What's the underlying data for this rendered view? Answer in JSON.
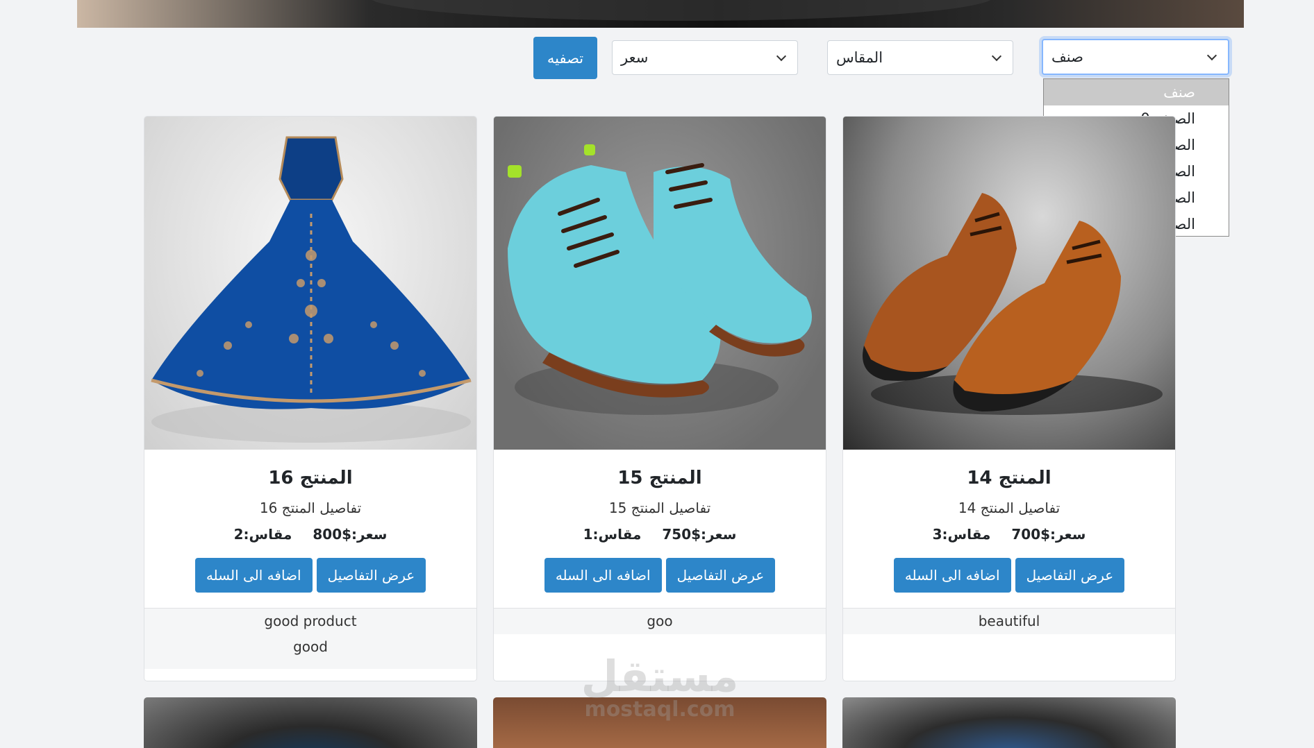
{
  "filters": {
    "apply_label": "تصفيه",
    "price_label": "سعر",
    "size_label": "المقاس",
    "category_label": "صنف",
    "category_options": [
      "صنف",
      "الصنف 0",
      "الصنف 1",
      "الصنف 2",
      "الصنف 3",
      "الصنف 4"
    ]
  },
  "products": [
    {
      "title": "المنتج 16",
      "details": "تفاصيل المنتج 16",
      "price": "سعر:$800",
      "size": "مقاس:2",
      "details_button": "عرض التفاصيل",
      "cart_button": "اضافه الى السله",
      "reviews": [
        "good product",
        "good"
      ]
    },
    {
      "title": "المنتج 15",
      "details": "تفاصيل المنتج 15",
      "price": "سعر:$750",
      "size": "مقاس:1",
      "details_button": "عرض التفاصيل",
      "cart_button": "اضافه الى السله",
      "reviews": [
        "goo"
      ]
    },
    {
      "title": "المنتج 14",
      "details": "تفاصيل المنتج 14",
      "price": "سعر:$700",
      "size": "مقاس:3",
      "details_button": "عرض التفاصيل",
      "cart_button": "اضافه الى السله",
      "reviews": [
        "beautiful"
      ]
    }
  ],
  "watermark": {
    "arabic": "مستقل",
    "latin": "mostaql.com"
  },
  "colors": {
    "primary": "#2d86c9",
    "background": "#f2f3f5"
  }
}
